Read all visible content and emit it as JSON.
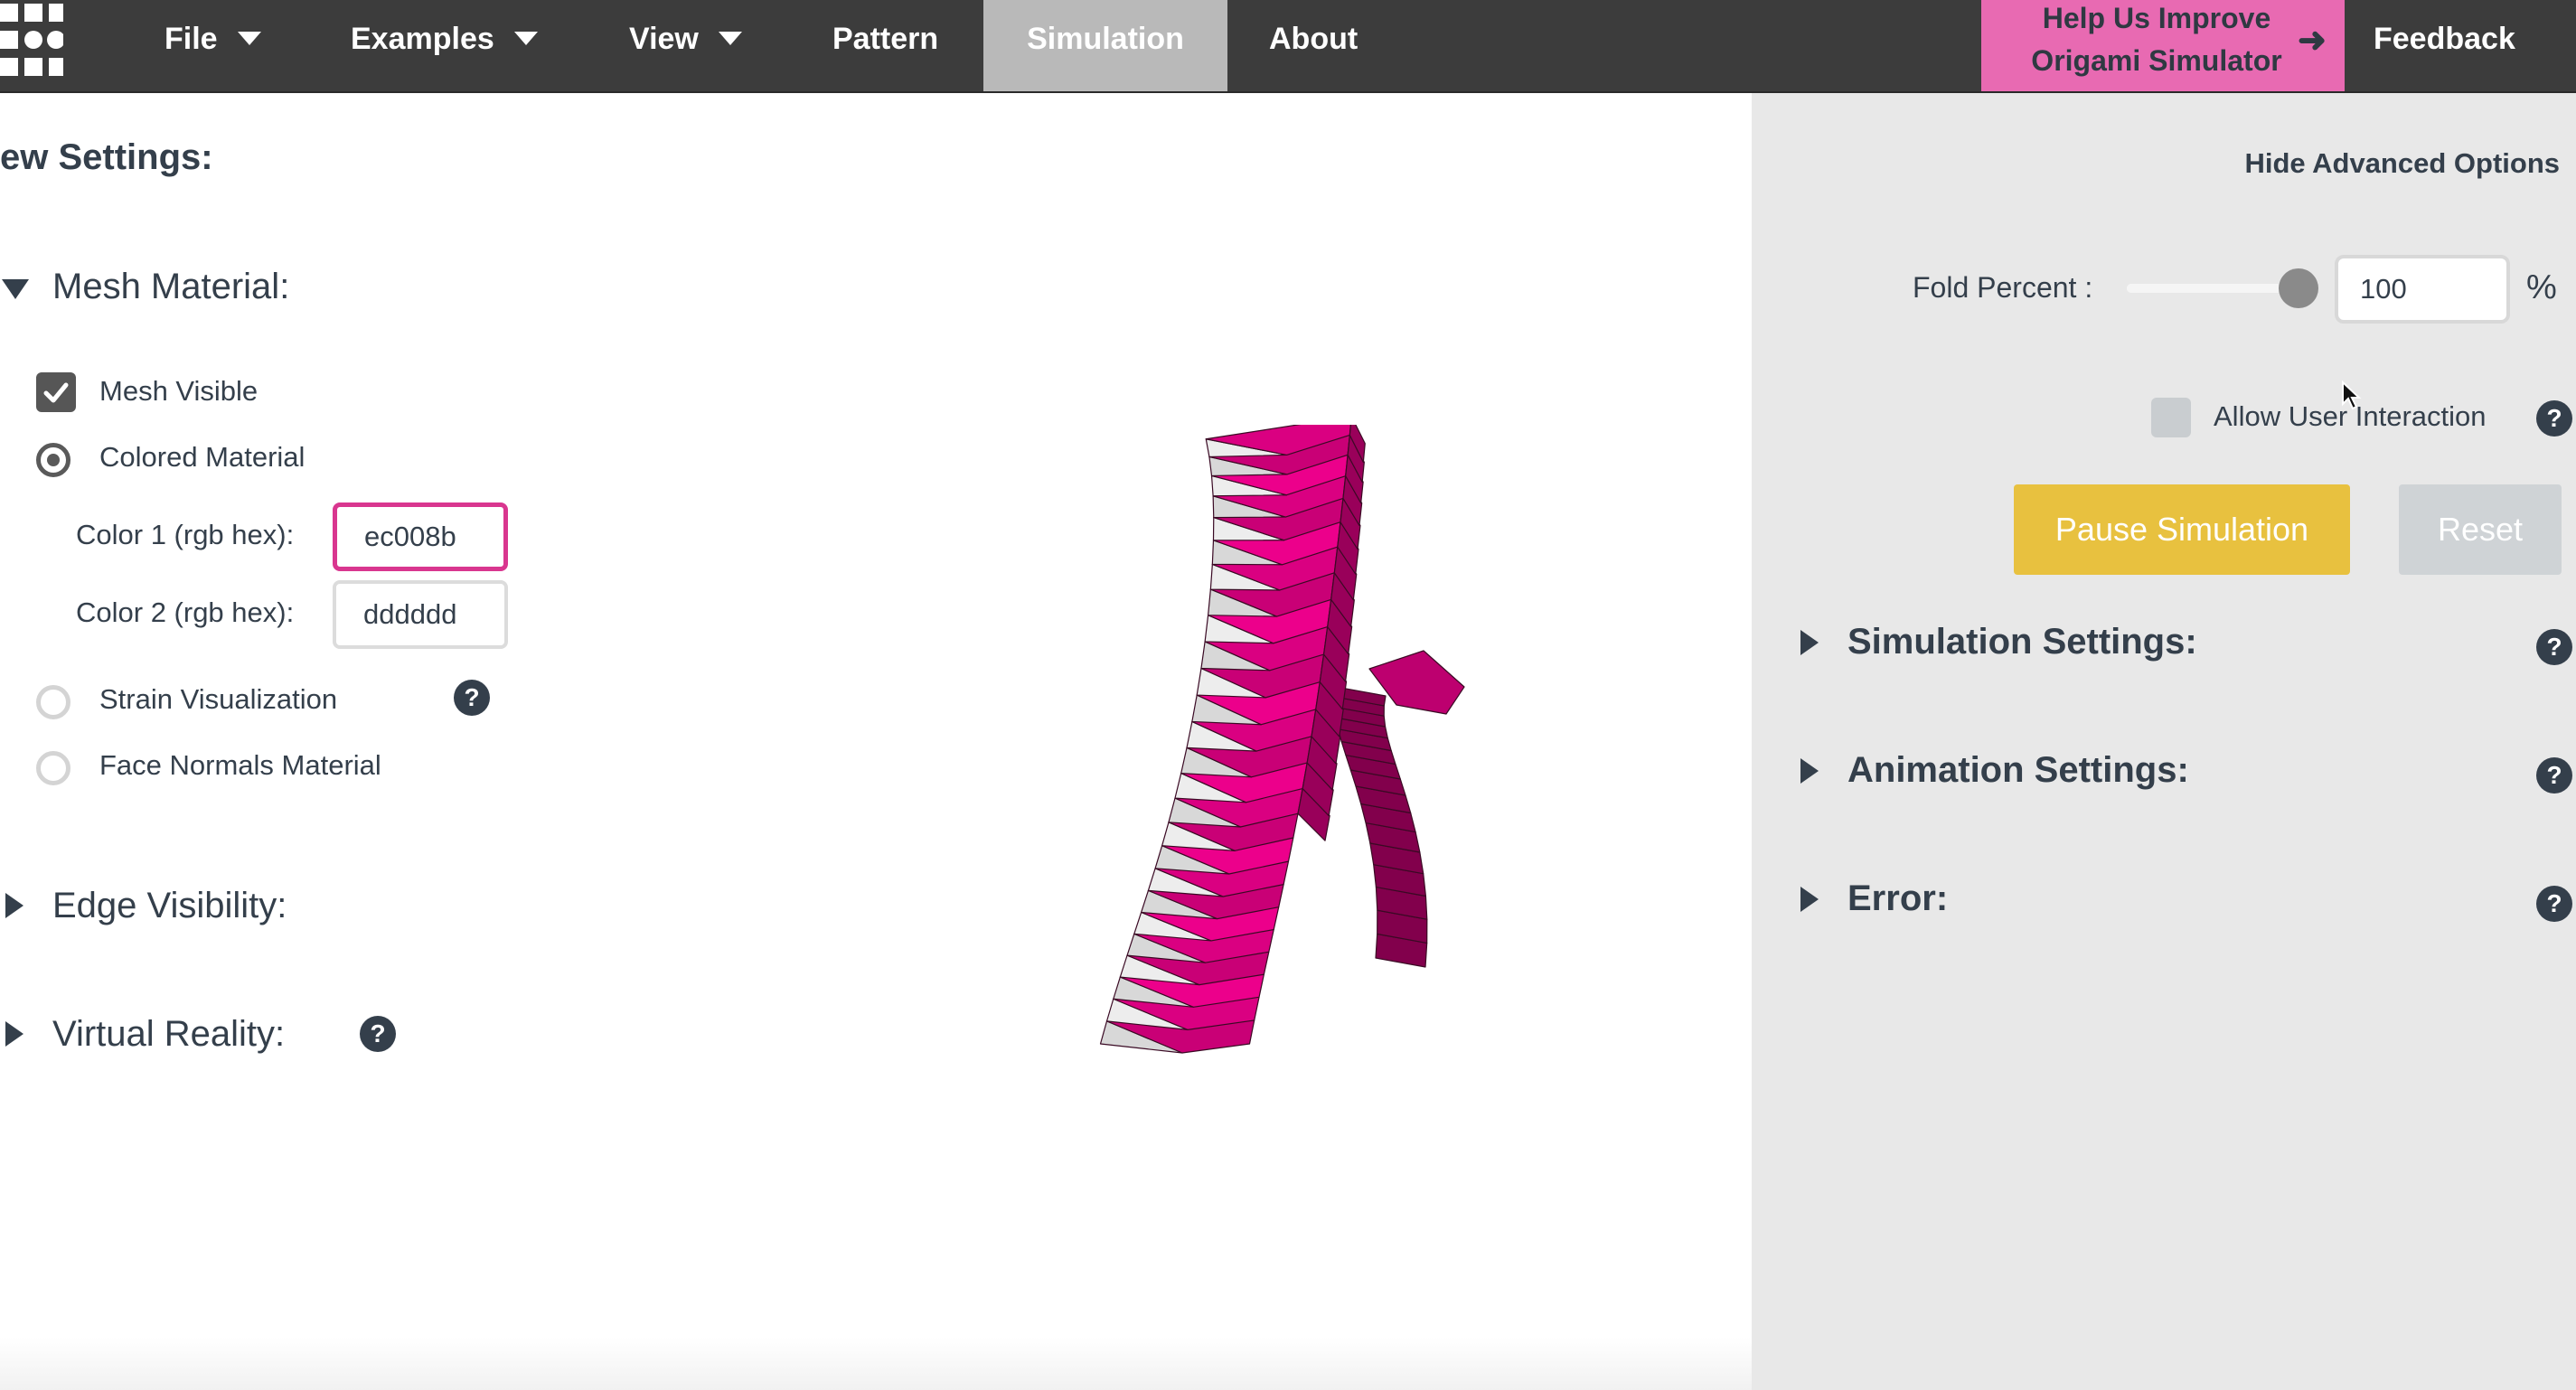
{
  "nav": {
    "file": "File",
    "examples": "Examples",
    "view": "View",
    "pattern": "Pattern",
    "simulation": "Simulation",
    "about": "About",
    "help_line1": "Help Us Improve",
    "help_line2": "Origami Simulator",
    "help_arrow": "➜",
    "feedback": "Feedback"
  },
  "view_settings": {
    "title": "ew Settings:",
    "mesh_material": {
      "heading": "Mesh Material:",
      "mesh_visible": "Mesh Visible",
      "mesh_visible_checked": true,
      "colored_material": "Colored Material",
      "color1_label": "Color 1 (rgb hex):",
      "color1_value": "ec008b",
      "color2_label": "Color 2 (rgb hex):",
      "color2_value": "dddddd",
      "strain_visualization": "Strain Visualization",
      "face_normals": "Face Normals Material",
      "selected": "colored_material"
    },
    "edge_visibility": "Edge Visibility:",
    "virtual_reality": "Virtual Reality:"
  },
  "help_glyph": "?",
  "model_color": "#ec008b",
  "right_panel": {
    "hide_advanced": "Hide Advanced Options",
    "fold_percent_label": "Fold Percent :",
    "fold_percent_value": "100",
    "fold_percent_unit": "%",
    "fold_percent_level": 100,
    "allow_user_interaction": "Allow User Interaction",
    "allow_user_interaction_checked": false,
    "pause_button": "Pause Simulation",
    "reset_button": "Reset",
    "simulation_settings": "Simulation Settings:",
    "animation_settings": "Animation Settings:",
    "error": "Error:"
  },
  "colors": {
    "nav_bg": "#3c3c3c",
    "active_tab": "#b9b9b9",
    "help_bg": "#e86ab2",
    "pause_bg": "#e8c13f",
    "reset_bg": "#cfd3d6",
    "accent_pink": "#ec008b"
  }
}
